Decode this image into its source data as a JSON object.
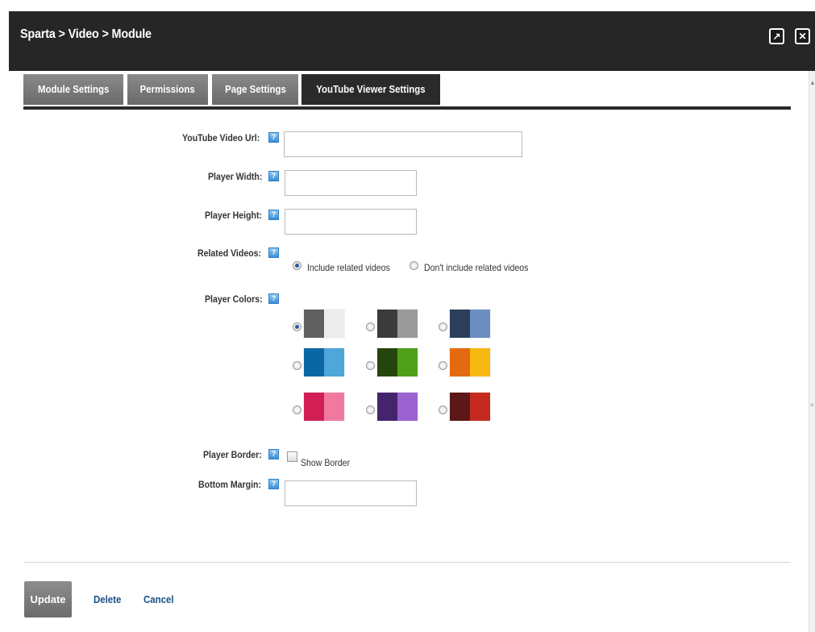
{
  "window": {
    "title": "Sparta > Video > Module",
    "popout_icon": "↗",
    "close_icon": "✕"
  },
  "tabs": [
    {
      "label": "Module Settings",
      "active": false
    },
    {
      "label": "Permissions",
      "active": false
    },
    {
      "label": "Page Settings",
      "active": false
    },
    {
      "label": "YouTube Viewer Settings",
      "active": true
    }
  ],
  "form": {
    "help_icon_text": "?",
    "youtube_url": {
      "label": "YouTube Video Url:",
      "value": ""
    },
    "player_width": {
      "label": "Player Width:",
      "value": ""
    },
    "player_height": {
      "label": "Player Height:",
      "value": ""
    },
    "related_videos": {
      "label": "Related Videos:",
      "options": [
        "Include related videos",
        "Don't include related videos"
      ],
      "selected": "Include related videos"
    },
    "player_colors": {
      "label": "Player Colors:",
      "selected_index": 0,
      "swatches": [
        {
          "a": "#606060",
          "b": "#ededed"
        },
        {
          "a": "#3b3b3b",
          "b": "#9a9a9a"
        },
        {
          "a": "#2b3f5c",
          "b": "#6a8fc0"
        },
        {
          "a": "#0a67a4",
          "b": "#4fa6d8"
        },
        {
          "a": "#24460c",
          "b": "#4ea01a"
        },
        {
          "a": "#e46a10",
          "b": "#f7b911"
        },
        {
          "a": "#d11f56",
          "b": "#f07a9f"
        },
        {
          "a": "#45246e",
          "b": "#9a63d0"
        },
        {
          "a": "#5c1716",
          "b": "#c52a1e"
        }
      ]
    },
    "player_border": {
      "label": "Player Border:",
      "checkbox_label": "Show Border",
      "checked": false
    },
    "bottom_margin": {
      "label": "Bottom Margin:",
      "value": ""
    }
  },
  "actions": {
    "update_label": "Update",
    "delete_label": "Delete",
    "cancel_label": "Cancel"
  }
}
